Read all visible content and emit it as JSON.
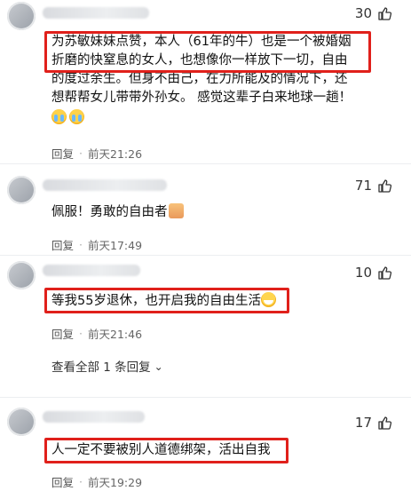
{
  "comments": [
    {
      "likes": "30",
      "text_lines": [
        "为苏敏妹妹点赞，本人（61年的牛）也是一个被婚姻",
        "折磨的快窒息的女人，也想像你一样放下一切，自由",
        "的度过余生。但身不由己，在力所能及的情况下，还",
        "想帮帮女儿带带外孙女。 感觉这辈子白来地球一趟！"
      ],
      "emoji_icons": [
        "crying-face",
        "crying-face"
      ],
      "reply_label": "回复",
      "time": "前天21:26"
    },
    {
      "likes": "71",
      "text": "佩服！勇敢的自由者",
      "emoji_icon": "thumbs-up",
      "reply_label": "回复",
      "time": "前天17:49"
    },
    {
      "likes": "10",
      "text": "等我55岁退休，也开启我的自由生活",
      "emoji_icon": "grinning-face",
      "reply_label": "回复",
      "time": "前天21:46",
      "view_all": "查看全部 1 条回复"
    },
    {
      "likes": "17",
      "text": "人一定不要被别人道德绑架，活出自我",
      "reply_label": "回复",
      "time": "前天19:29"
    }
  ],
  "colors": {
    "highlight": "#e0201b"
  }
}
